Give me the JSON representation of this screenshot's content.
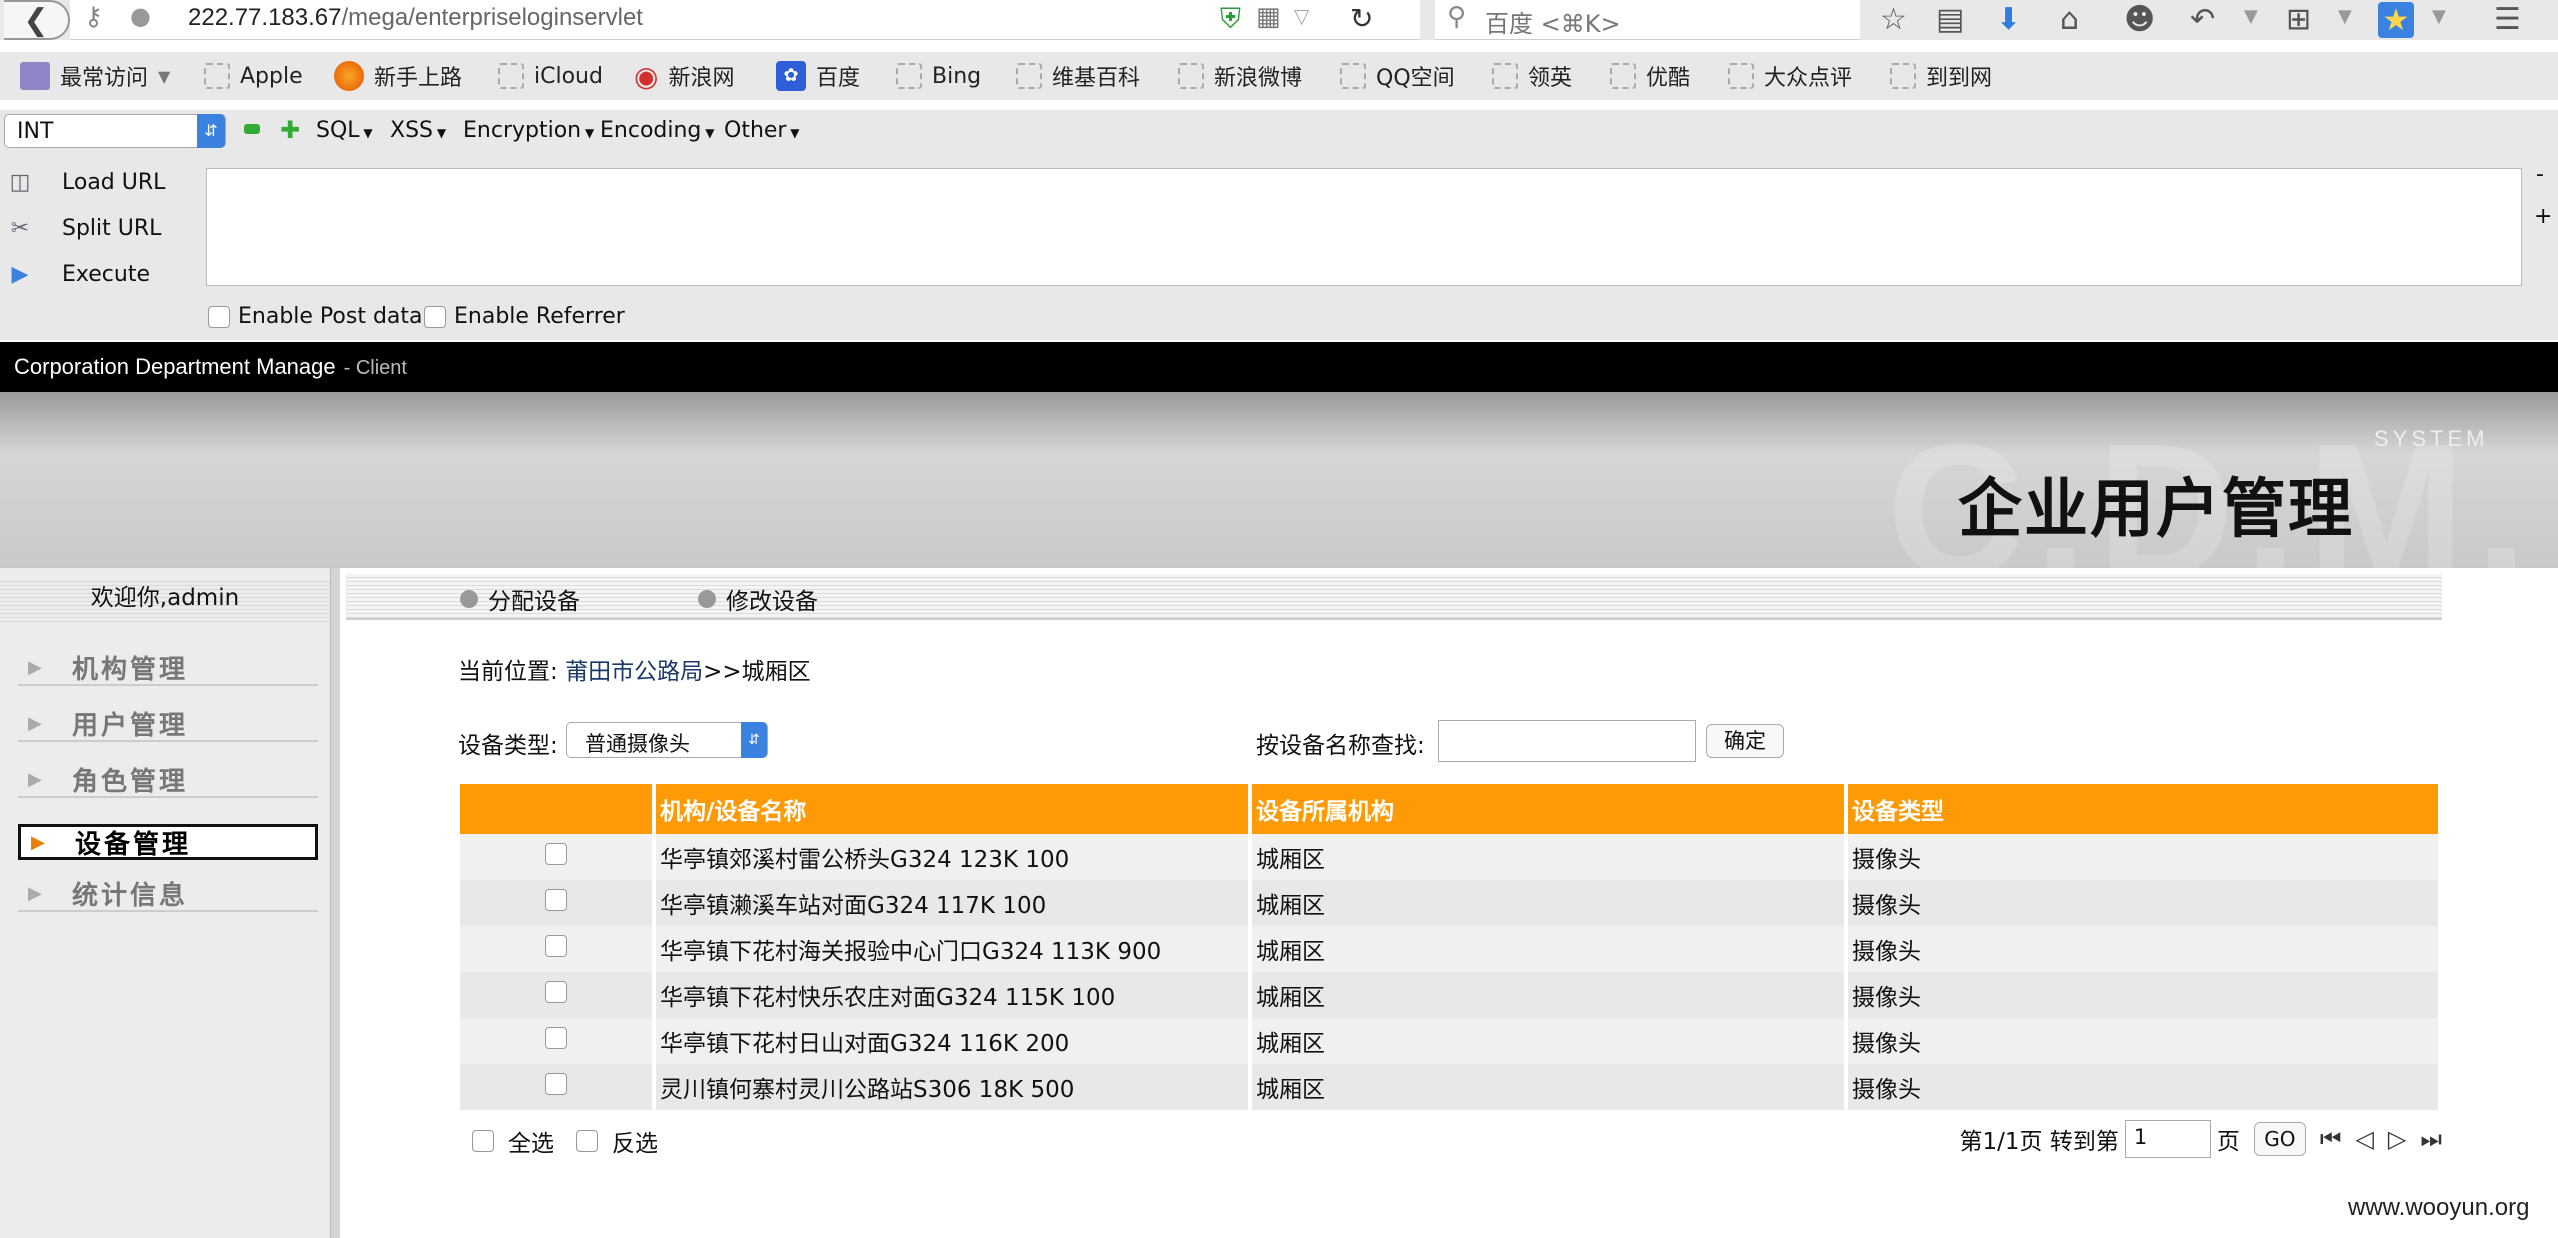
{
  "browser": {
    "url_host": "222.77.183.67",
    "url_path": "/mega/enterpriseloginservlet",
    "search_placeholder": "百度 <⌘K>"
  },
  "bookmarks": [
    "最常访问",
    "Apple",
    "新手上路",
    "iCloud",
    "新浪网",
    "百度",
    "Bing",
    "维基百科",
    "新浪微博",
    "QQ空间",
    "领英",
    "优酷",
    "大众点评",
    "到到网"
  ],
  "hackbar": {
    "selected": "INT",
    "menus": [
      "SQL",
      "XSS",
      "Encryption",
      "Encoding",
      "Other"
    ],
    "actions": [
      "Load URL",
      "Split URL",
      "Execute"
    ],
    "checks": [
      "Enable Post data",
      "Enable Referrer"
    ],
    "side_minus": "-",
    "side_plus": "+"
  },
  "app": {
    "bar_title": "Corporation Department Manage",
    "bar_subtitle": "- Client",
    "banner_watermark": "C.D.M.",
    "banner_system": "SYSTEM",
    "banner_title": "企业用户管理"
  },
  "sidebar": {
    "welcome": "欢迎你,admin",
    "items": [
      "机构管理",
      "用户管理",
      "角色管理",
      "设备管理",
      "统计信息"
    ],
    "active_index": 3
  },
  "tabs": [
    "分配设备",
    "修改设备"
  ],
  "breadcrumb": {
    "prefix": "当前位置: ",
    "path": "莆田市公路局",
    "separator": ">>",
    "current": "城厢区"
  },
  "filter": {
    "type_label": "设备类型:",
    "type_value": "普通摄像头",
    "search_label": "按设备名称查找:",
    "search_value": "",
    "confirm": "确定"
  },
  "table": {
    "headers": [
      "",
      "机构/设备名称",
      "设备所属机构",
      "设备类型"
    ],
    "rows": [
      [
        "华亭镇郊溪村雷公桥头G324 123K 100",
        "城厢区",
        "摄像头"
      ],
      [
        "华亭镇濑溪车站对面G324 117K 100",
        "城厢区",
        "摄像头"
      ],
      [
        "华亭镇下花村海关报验中心门口G324 113K 900",
        "城厢区",
        "摄像头"
      ],
      [
        "华亭镇下花村快乐农庄对面G324 115K 100",
        "城厢区",
        "摄像头"
      ],
      [
        "华亭镇下花村日山对面G324 116K 200",
        "城厢区",
        "摄像头"
      ],
      [
        "灵川镇何寨村灵川公路站S306 18K 500",
        "城厢区",
        "摄像头"
      ]
    ]
  },
  "footer": {
    "select_all": "全选",
    "invert": "反选",
    "page_info": "第1/1页 转到第",
    "page_input": "1",
    "page_suffix": "页",
    "go": "GO"
  },
  "watermark": "www.wooyun.org",
  "colors": {
    "header_orange": "#fe9a05",
    "app_bar": "#000000",
    "active_arrow": "#e67e00"
  }
}
